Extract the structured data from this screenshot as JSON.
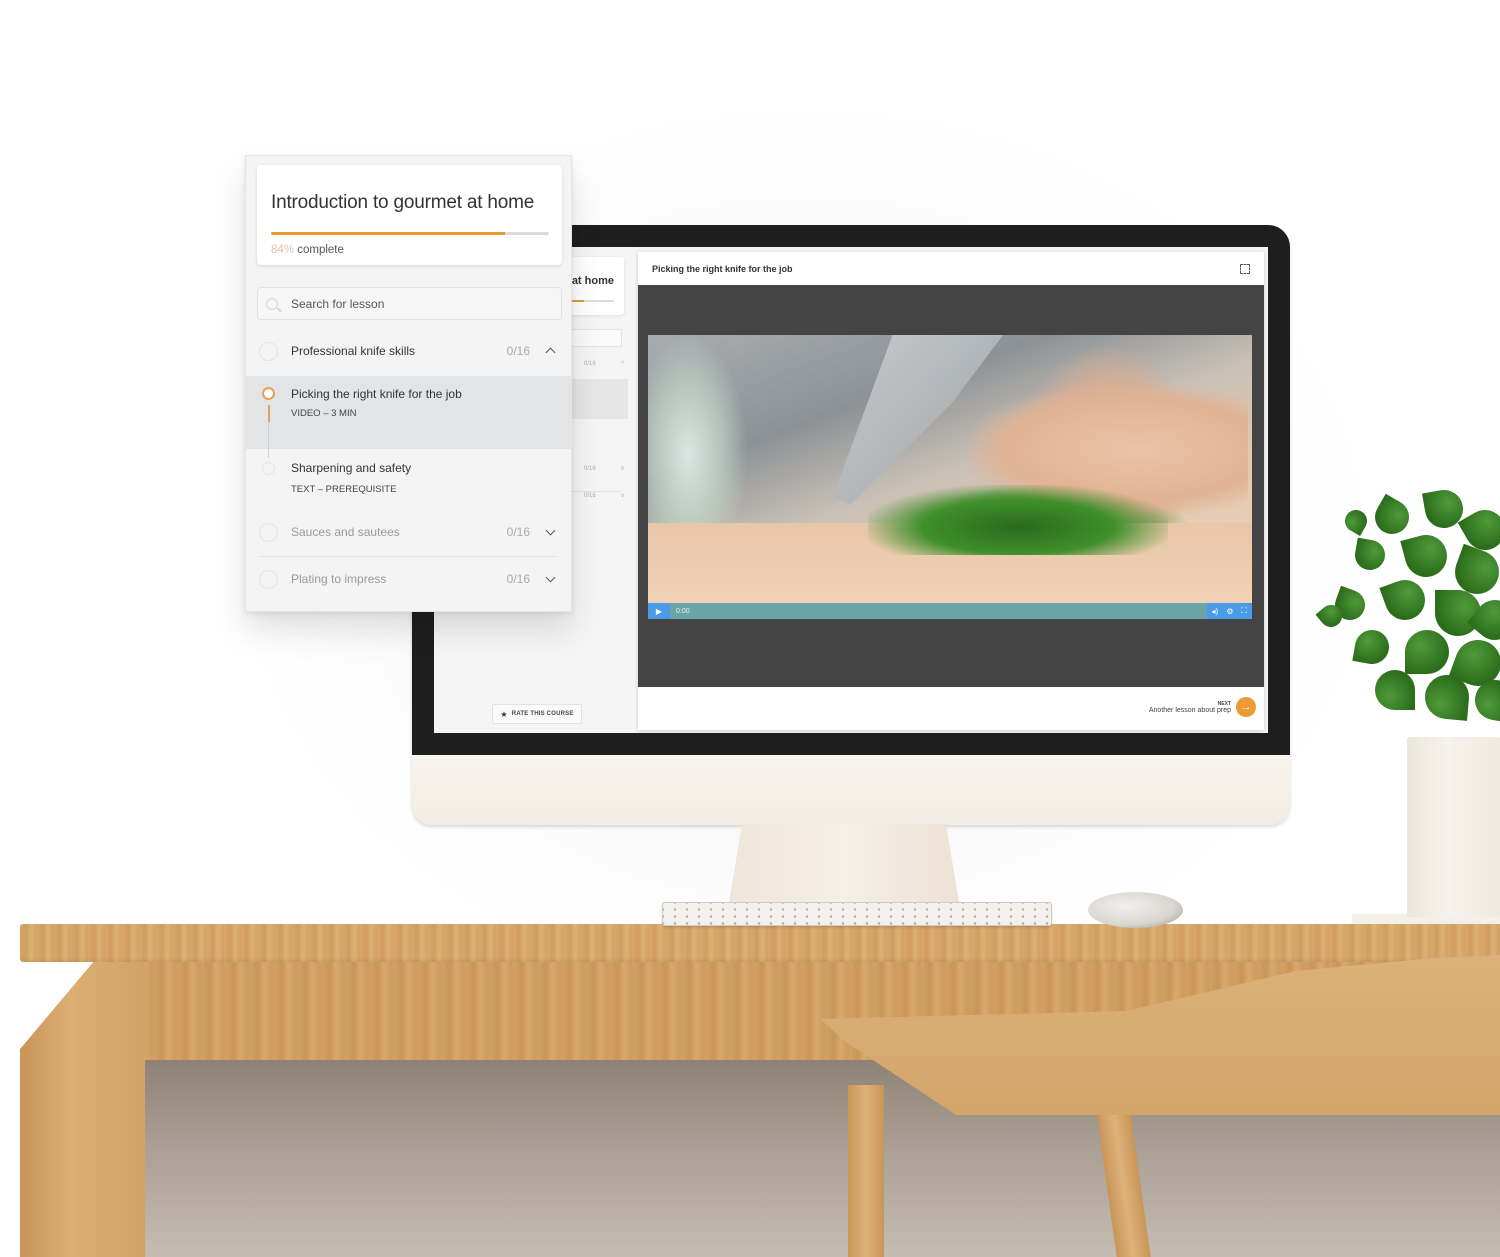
{
  "course_panel": {
    "title": "Introduction to gourmet at home",
    "progress_percent": 84,
    "progress_pct_label": "84%",
    "progress_suffix": "complete",
    "search_placeholder": "Search for lesson",
    "sections": [
      {
        "title": "Professional knife skills",
        "count": "0/16",
        "expanded": true,
        "lessons": [
          {
            "title": "Picking the right knife for the job",
            "meta": "VIDEO – 3 MIN",
            "state": "current"
          },
          {
            "title": "Sharpening and safety",
            "meta": "TEXT – PREREQUISITE",
            "state": "pending"
          }
        ]
      },
      {
        "title": "Sauces and sautees",
        "count": "0/16",
        "expanded": false
      },
      {
        "title": "Plating to impress",
        "count": "0/16",
        "expanded": false
      }
    ]
  },
  "screen": {
    "sidebar_title_fragment": "at home",
    "sidebar_counts": [
      "0/16",
      "0/16",
      "0/16"
    ],
    "rate_button_label": "RATE THIS COURSE",
    "lesson_title": "Picking the right knife for the job",
    "video": {
      "time": "0:00"
    },
    "next": {
      "label": "NEXT",
      "lesson": "Another lesson about prep"
    }
  },
  "icons": {
    "play": "▶",
    "volume": "🔊",
    "settings": "⚙",
    "fullscreen": "⛶",
    "star": "★",
    "arrow_right": "→"
  },
  "colors": {
    "accent": "#e99b33",
    "video_controls": "#6aa4a6",
    "video_controls_buttons": "#4a9be8"
  }
}
